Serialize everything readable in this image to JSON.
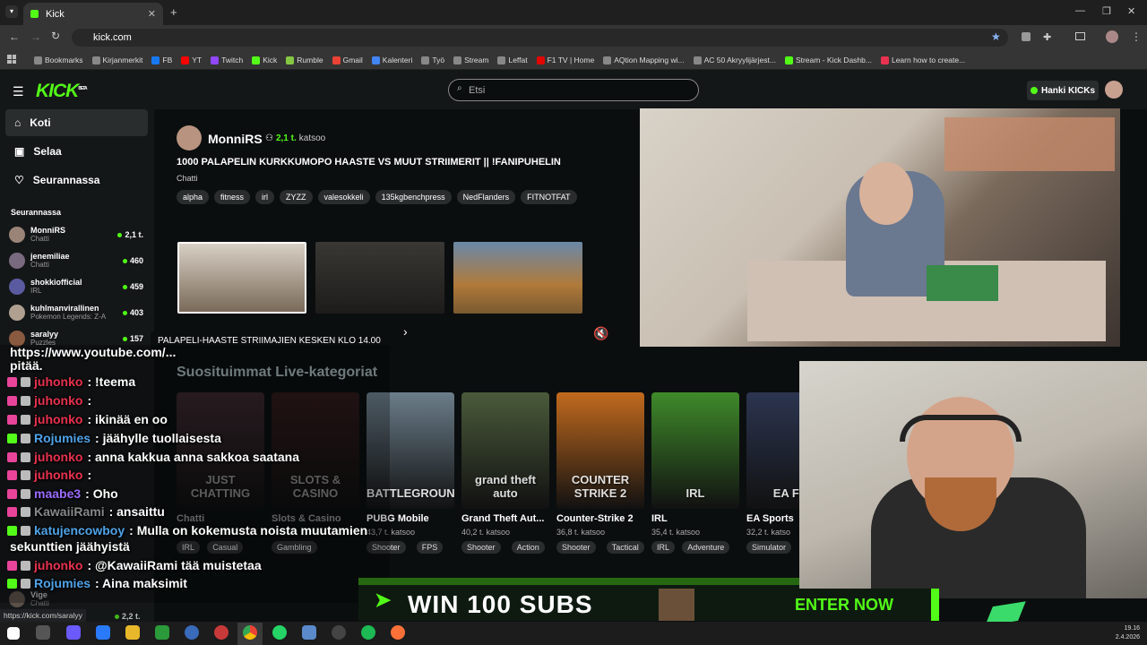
{
  "browser": {
    "tab_title": "Kick",
    "url": "kick.com",
    "status_url": "https://kick.com/saralyy",
    "bookmarks": [
      "Bookmarks",
      "Kirjanmerkit",
      "FB",
      "YT",
      "Twitch",
      "Kick",
      "Rumble",
      "Gmail",
      "Kalenteri",
      "Työ",
      "Stream",
      "Leffat",
      "F1 TV | Home",
      "AQtion Mapping wi...",
      "AC 50 Akryylijärjest...",
      "Stream - Kick Dashb...",
      "Learn how to create..."
    ]
  },
  "kick": {
    "logo": "KICK",
    "beta": "BETA",
    "search_placeholder": "Etsi",
    "get_kicks": "Hanki KICKs",
    "nav": [
      "Koti",
      "Selaa",
      "Seurannassa"
    ],
    "following_title": "Seurannassa",
    "following": [
      {
        "name": "MonniRS",
        "category": "Chatti",
        "viewers": "2,1 t."
      },
      {
        "name": "jenemiliae",
        "category": "Chatti",
        "viewers": "460"
      },
      {
        "name": "shokkiofficial",
        "category": "IRL",
        "viewers": "459"
      },
      {
        "name": "kuhlmanvirallinen",
        "category": "Pokemon Legends: Z-A",
        "viewers": "403"
      },
      {
        "name": "saralyy",
        "category": "Puzzles",
        "viewers": "157"
      }
    ],
    "sidebar_bottom": {
      "name": "Vige",
      "category": "Chatti",
      "viewers": "2,2 t."
    },
    "featured": {
      "streamer": "MonniRS",
      "viewers": "2,1 t.",
      "watching": "katsoo",
      "title": "1000 PALAPELIN KURKKUMOPO HAASTE VS MUUT STRIIMERIT || !FANIPUHELIN",
      "category": "Chatti",
      "tags": [
        "alpha",
        "fitness",
        "irl",
        "ZYZZ",
        "valesokkeli",
        "135kgbenchpress",
        "NedFlanders",
        "FITNOTFAT"
      ]
    },
    "tooltip": "PALAPELI-HAASTE STRIIMAJIEN KESKEN KLO 14.00",
    "popular_title": "Suosituimmat Live-kategoriat",
    "categories": [
      {
        "name": "Chatti",
        "viewers": "",
        "tags": [
          "IRL",
          "Casual"
        ],
        "art": "JUST CHATTING",
        "color": "#5a3a45"
      },
      {
        "name": "Slots & Casino",
        "viewers": "",
        "tags": [
          "Gambling"
        ],
        "art": "SLOTS & CASINO",
        "color": "#4a2222"
      },
      {
        "name": "PUBG Mobile",
        "viewers": "43,7 t. katsoo",
        "tags": [
          "Shooter",
          "FPS"
        ],
        "art": "BATTLEGROUNDS",
        "color": "#6b7d8a"
      },
      {
        "name": "Grand Theft Aut...",
        "viewers": "40,2 t. katsoo",
        "tags": [
          "Shooter",
          "Action"
        ],
        "art": "grand theft auto",
        "color": "#4a5a3a"
      },
      {
        "name": "Counter-Strike 2",
        "viewers": "36,8 t. katsoo",
        "tags": [
          "Shooter",
          "Tactical"
        ],
        "art": "COUNTER STRIKE 2",
        "color": "#c26a1e"
      },
      {
        "name": "IRL",
        "viewers": "35,4 t. katsoo",
        "tags": [
          "IRL",
          "Adventure"
        ],
        "art": "IRL",
        "color": "#3f8a2a"
      },
      {
        "name": "EA Sports",
        "viewers": "32,2 t. katso",
        "tags": [
          "Simulator"
        ],
        "art": "EA FC",
        "color": "#2c3550"
      }
    ]
  },
  "chat": [
    {
      "user": "",
      "text": "https://www.youtube.com/...",
      "color": "#fff"
    },
    {
      "user": "",
      "text": "pitää.",
      "color": "#fff"
    },
    {
      "user": "juhonko",
      "text": ": !teema",
      "color": "#e8324f"
    },
    {
      "user": "juhonko",
      "text": ":",
      "color": "#e8324f"
    },
    {
      "user": "juhonko",
      "text": ": ikinää en oo",
      "color": "#e8324f"
    },
    {
      "user": "Rojumies",
      "text": ": jäähylle tuollaisesta",
      "color": "#4fa3e8"
    },
    {
      "user": "juhonko",
      "text": ": anna kakkua anna sakkoa saatana",
      "color": "#e8324f"
    },
    {
      "user": "juhonko",
      "text": ":",
      "color": "#e8324f"
    },
    {
      "user": "maabe3",
      "text": ": Oho",
      "color": "#9b6bff"
    },
    {
      "user": "KawaiiRami",
      "text": ": ansaittu",
      "color": "#888"
    },
    {
      "user": "katujencowboy",
      "text": ": Mulla on kokemusta noista muutamien",
      "color": "#4fa3e8"
    },
    {
      "user": "",
      "text": "sekunttien jäähyistä",
      "color": "#fff"
    },
    {
      "user": "juhonko",
      "text": ": @KawaiiRami tää muistetaa",
      "color": "#e8324f"
    },
    {
      "user": "Rojumies",
      "text": ": Aina maksimit",
      "color": "#4fa3e8"
    }
  ],
  "ad": {
    "headline": "WIN 100 SUBS",
    "cta": "ENTER NOW"
  },
  "clock": {
    "time": "19.16",
    "date": "2.4.2026"
  }
}
